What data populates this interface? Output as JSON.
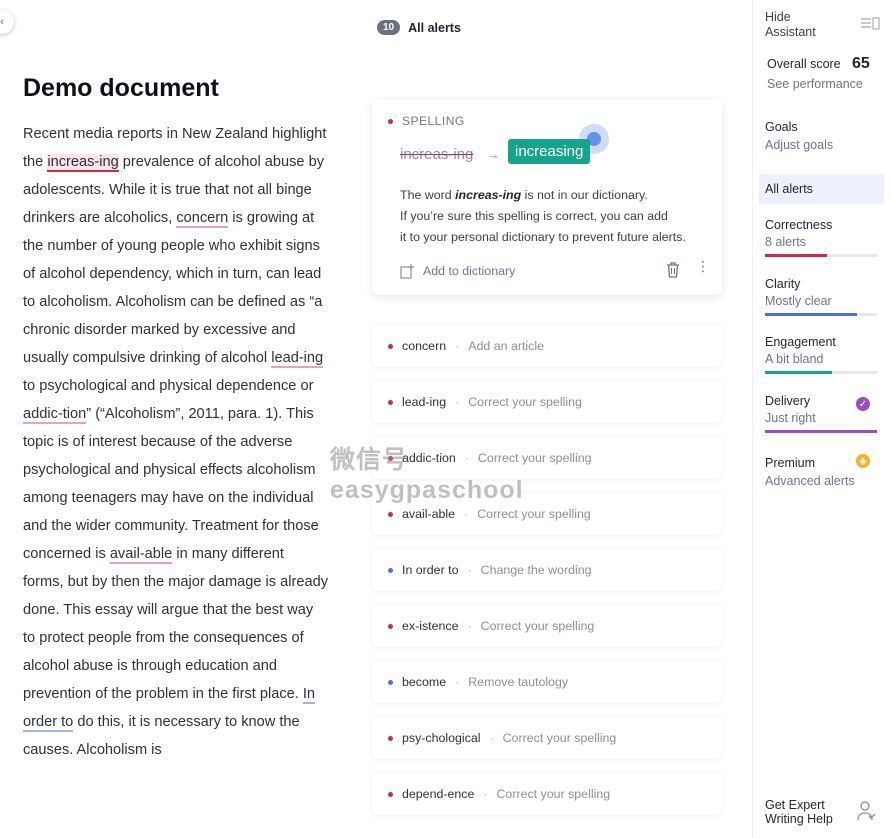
{
  "document": {
    "title": "Demo document",
    "segments": [
      {
        "t": "Recent media reports in New Zealand highlight the "
      },
      {
        "t": "increas-ing",
        "u": "red-active"
      },
      {
        "t": " prevalence of alcohol abuse by adolescents. While it is true that not all binge drinkers are alcoholics, "
      },
      {
        "t": "concern",
        "u": "red"
      },
      {
        "t": " is growing at the number of young people who exhibit signs of alcohol dependency, which in turn, can lead to alcoholism. Alcoholism can be defined as “a chronic disorder marked by excessive and usually compulsive drinking of alcohol "
      },
      {
        "t": "lead-ing",
        "u": "red"
      },
      {
        "t": " to psychological and physical dependence or "
      },
      {
        "t": "addic-tion",
        "u": "red"
      },
      {
        "t": "” (“Alcoholism”, 2011, para. 1). This topic is of interest because of the adverse psychological and physical effects alcoholism among teenagers may have on the individual and the wider community. Treatment for those concerned is "
      },
      {
        "t": "avail-able",
        "u": "red"
      },
      {
        "t": " in many different forms, but by then the major damage is already done. This essay will argue that the best way to protect people from the consequences of alcohol abuse is through education and prevention of the problem in the first place. "
      },
      {
        "t": "In order to",
        "u": "blue"
      },
      {
        "t": " do this, it is necessary to know the causes. Alcoholism is"
      }
    ]
  },
  "alerts": {
    "count": "10",
    "title": "All alerts",
    "expanded": {
      "category": "SPELLING",
      "original": "increas-ing",
      "arrow": "→",
      "suggestion": "increasing",
      "desc_pre": "The word ",
      "desc_word": "increas-ing",
      "desc_post": " is not in our dictionary.",
      "desc_line2": "If you’re sure this spelling is correct, you can add",
      "desc_line3": "it to your personal dictionary to prevent future alerts.",
      "add_label": "Add to dictionary"
    },
    "items": [
      {
        "term": "concern",
        "hint": "Add an article",
        "color": "red"
      },
      {
        "term": "lead-ing",
        "hint": "Correct your spelling",
        "color": "red"
      },
      {
        "term": "addic-tion",
        "hint": "Correct your spelling",
        "color": "red"
      },
      {
        "term": "avail-able",
        "hint": "Correct your spelling",
        "color": "red"
      },
      {
        "term": "In order to",
        "hint": "Change the wording",
        "color": "blue"
      },
      {
        "term": "ex-istence",
        "hint": "Correct your spelling",
        "color": "red"
      },
      {
        "term": "become",
        "hint": "Remove tautology",
        "color": "blue"
      },
      {
        "term": "psy-chological",
        "hint": "Correct your spelling",
        "color": "red"
      },
      {
        "term": "depend-ence",
        "hint": "Correct your spelling",
        "color": "red"
      }
    ],
    "separator": "·"
  },
  "watermark": {
    "line1": "微信号",
    "line2": "easygpaschool"
  },
  "sidebar": {
    "hide_line1": "Hide",
    "hide_line2": "Assistant",
    "overall_label": "Overall score",
    "overall_score": "65",
    "see_performance": "See performance",
    "goals": "Goals",
    "adjust_goals": "Adjust goals",
    "all_alerts": "All alerts",
    "metrics": [
      {
        "title": "Correctness",
        "sub": "8 alerts",
        "level": 0.55,
        "color": "#d0284f"
      },
      {
        "title": "Clarity",
        "sub": "Mostly clear",
        "level": 0.82,
        "color": "#4a6ee0"
      },
      {
        "title": "Engagement",
        "sub": "A bit bland",
        "level": 0.6,
        "color": "#15a58a"
      },
      {
        "title": "Delivery",
        "sub": "Just right",
        "level": 1.0,
        "color": "#9b4fc0"
      }
    ],
    "premium": "Premium",
    "premium_sub": "Advanced alerts",
    "expert_line1": "Get Expert",
    "expert_line2": "Writing Help"
  }
}
